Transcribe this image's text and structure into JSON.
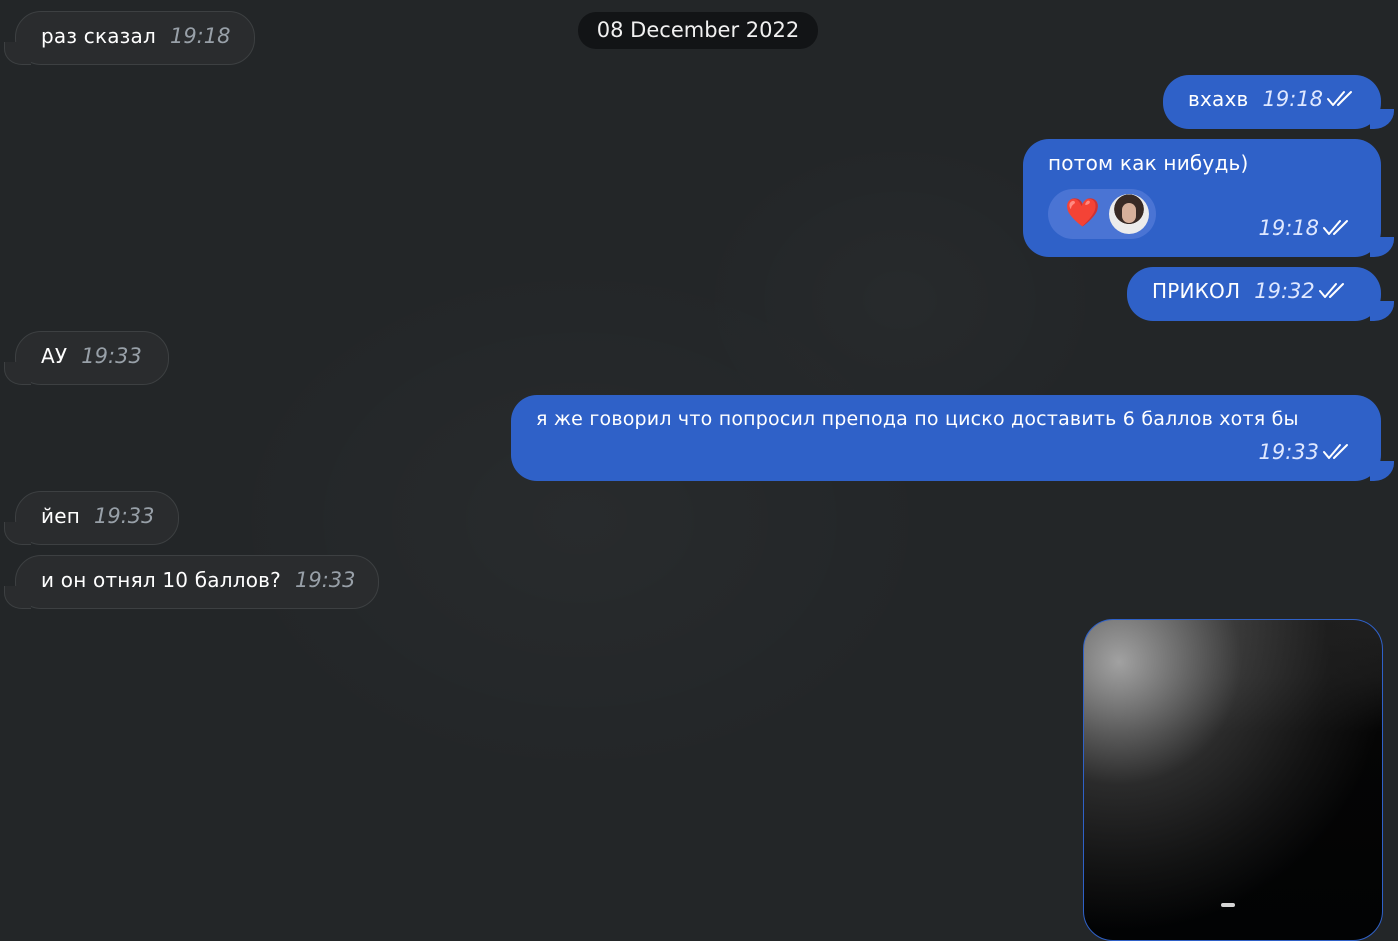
{
  "date_separator": "08 December 2022",
  "messages": [
    {
      "direction": "incoming",
      "text": "раз сказал",
      "time": "19:18"
    },
    {
      "direction": "outgoing",
      "text": "вхахв",
      "time": "19:18",
      "status": "double-check-icon"
    },
    {
      "direction": "outgoing",
      "text": "потом как нибудь)",
      "time": "19:18",
      "status": "double-check-icon",
      "reactions": [
        {
          "emoji": "❤️",
          "icon": "heart-icon"
        },
        {
          "icon": "avatar"
        }
      ]
    },
    {
      "direction": "outgoing",
      "text": "ПРИКОЛ",
      "time": "19:32",
      "status": "double-check-icon"
    },
    {
      "direction": "incoming",
      "text": "АУ",
      "time": "19:33"
    },
    {
      "direction": "outgoing",
      "text": "я же говорил что попросил препода по циско доставить 6 баллов хотя бы",
      "time": "19:33",
      "status": "double-check-icon"
    },
    {
      "direction": "incoming",
      "text": "йеп",
      "time": "19:33"
    },
    {
      "direction": "incoming",
      "text": "и он отнял 10 баллов?",
      "time": "19:33"
    },
    {
      "direction": "outgoing",
      "type": "media",
      "description": "dark image"
    }
  ],
  "colors": {
    "background": "#232628",
    "incoming_bubble": "#2a2c2e",
    "outgoing_bubble": "#2f61c8",
    "time_incoming": "#98a0a8",
    "time_outgoing": "#dfe8ff"
  }
}
